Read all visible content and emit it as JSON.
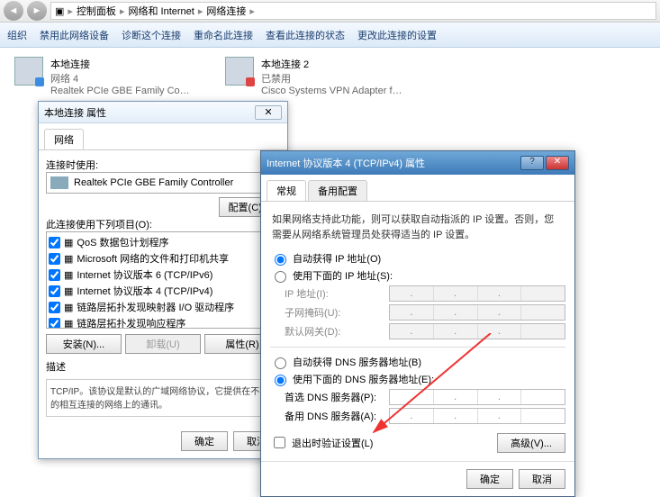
{
  "breadcrumb": [
    "控制面板",
    "网络和 Internet",
    "网络连接"
  ],
  "toolbar": {
    "org": "组织",
    "items": [
      "禁用此网络设备",
      "诊断这个连接",
      "重命名此连接",
      "查看此连接的状态",
      "更改此连接的设置"
    ]
  },
  "connections": [
    {
      "name": "本地连接",
      "status": "网络 4",
      "adapter": "Realtek PCIe GBE Family Contr..."
    },
    {
      "name": "本地连接 2",
      "status": "已禁用",
      "adapter": "Cisco Systems VPN Adapter fo..."
    }
  ],
  "dlg1": {
    "title": "本地连接 属性",
    "tab": "网络",
    "connect_using": "连接时使用:",
    "adapter": "Realtek PCIe GBE Family Controller",
    "configure": "配置(C)...",
    "items_label": "此连接使用下列项目(O):",
    "items": [
      "QoS 数据包计划程序",
      "Microsoft 网络的文件和打印机共享",
      "Internet 协议版本 6 (TCP/IPv6)",
      "Internet 协议版本 4 (TCP/IPv4)",
      "链路层拓扑发现映射器 I/O 驱动程序",
      "链路层拓扑发现响应程序"
    ],
    "install": "安装(N)...",
    "uninstall": "卸载(U)",
    "properties": "属性(R)",
    "desc_label": "描述",
    "desc": "TCP/IP。该协议是默认的广域网络协议，它提供在不同的相互连接的网络上的通讯。",
    "ok": "确定",
    "cancel": "取消"
  },
  "dlg2": {
    "title": "Internet 协议版本 4 (TCP/IPv4) 属性",
    "tabs": [
      "常规",
      "备用配置"
    ],
    "info": "如果网络支持此功能，则可以获取自动指派的 IP 设置。否则，您需要从网络系统管理员处获得适当的 IP 设置。",
    "ip_auto": "自动获得 IP 地址(O)",
    "ip_manual": "使用下面的 IP 地址(S):",
    "ip_addr": "IP 地址(I):",
    "subnet": "子网掩码(U):",
    "gateway": "默认网关(D):",
    "dns_auto": "自动获得 DNS 服务器地址(B)",
    "dns_manual": "使用下面的 DNS 服务器地址(E):",
    "dns1": "首选 DNS 服务器(P):",
    "dns2": "备用 DNS 服务器(A):",
    "validate": "退出时验证设置(L)",
    "advanced": "高级(V)...",
    "ok": "确定",
    "cancel": "取消"
  }
}
